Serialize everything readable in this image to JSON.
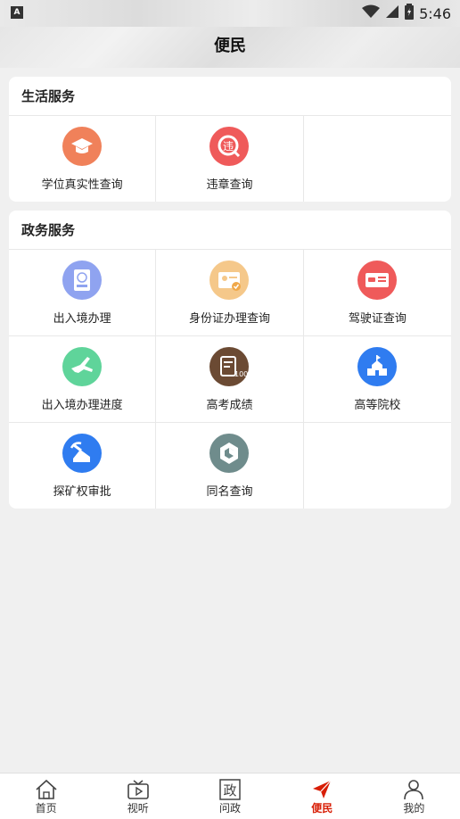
{
  "status": {
    "time": "5:46",
    "app_icon": "A"
  },
  "header": {
    "title": "便民"
  },
  "life": {
    "title": "生活服务",
    "items": [
      {
        "label": "学位真实性查询",
        "icon": "graduation-cap-icon",
        "color": "#f0815a"
      },
      {
        "label": "违章查询",
        "icon": "violation-search-icon",
        "color": "#ef5a5a"
      }
    ]
  },
  "gov": {
    "title": "政务服务",
    "items": [
      {
        "label": "出入境办理",
        "icon": "passport-icon",
        "color": "#8fa3f0"
      },
      {
        "label": "身份证办理查询",
        "icon": "id-card-icon",
        "color": "#f5c88a"
      },
      {
        "label": "驾驶证查询",
        "icon": "driver-license-icon",
        "color": "#ef5a5a"
      },
      {
        "label": "出入境办理进度",
        "icon": "airplane-icon",
        "color": "#5fd49a"
      },
      {
        "label": "高考成绩",
        "icon": "exam-score-icon",
        "color": "#6b4a33"
      },
      {
        "label": "高等院校",
        "icon": "university-icon",
        "color": "#2f7cf0"
      },
      {
        "label": "探矿权审批",
        "icon": "mining-icon",
        "color": "#2f7cf0"
      },
      {
        "label": "同名查询",
        "icon": "same-name-icon",
        "color": "#6f8c8c"
      }
    ]
  },
  "tabs": [
    {
      "label": "首页",
      "icon": "home-icon"
    },
    {
      "label": "视听",
      "icon": "tv-icon"
    },
    {
      "label": "问政",
      "icon": "zheng-icon",
      "glyph": "政"
    },
    {
      "label": "便民",
      "icon": "send-icon",
      "active": true,
      "color": "#d81e06"
    },
    {
      "label": "我的",
      "icon": "user-icon"
    }
  ]
}
